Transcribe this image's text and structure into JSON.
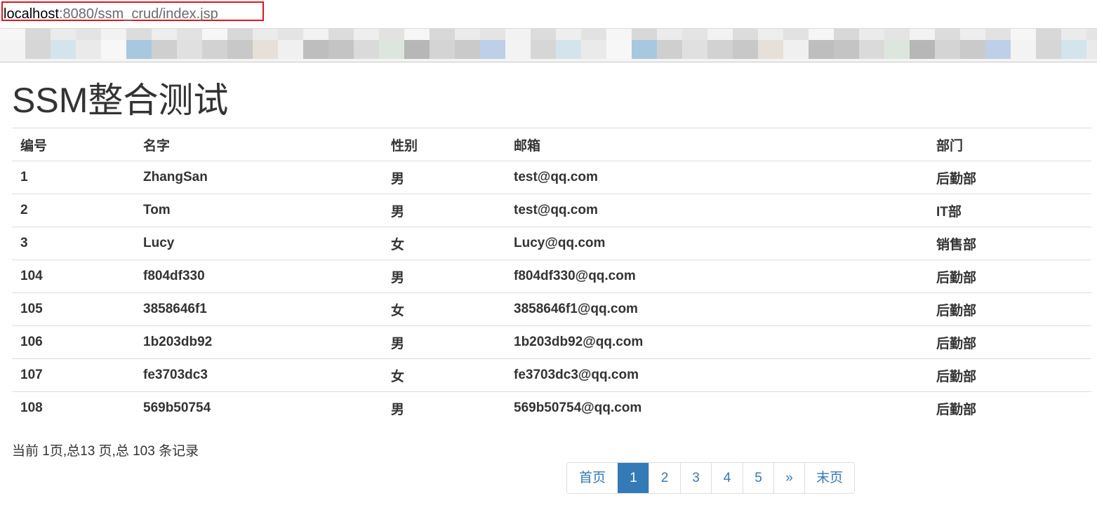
{
  "browser": {
    "url_host": "localhost",
    "url_path": ":8080/ssm_crud/index.jsp",
    "highlight_color": "#e0161b"
  },
  "page": {
    "title": "SSM整合测试"
  },
  "table": {
    "headers": [
      "编号",
      "名字",
      "性别",
      "邮箱",
      "部门"
    ],
    "rows": [
      [
        "1",
        "ZhangSan",
        "男",
        "test@qq.com",
        "后勤部"
      ],
      [
        "2",
        "Tom",
        "男",
        "test@qq.com",
        "IT部"
      ],
      [
        "3",
        "Lucy",
        "女",
        "Lucy@qq.com",
        "销售部"
      ],
      [
        "104",
        "f804df330",
        "男",
        "f804df330@qq.com",
        "后勤部"
      ],
      [
        "105",
        "3858646f1",
        "女",
        "3858646f1@qq.com",
        "后勤部"
      ],
      [
        "106",
        "1b203db92",
        "男",
        "1b203db92@qq.com",
        "后勤部"
      ],
      [
        "107",
        "fe3703dc3",
        "女",
        "fe3703dc3@qq.com",
        "后勤部"
      ],
      [
        "108",
        "569b50754",
        "男",
        "569b50754@qq.com",
        "后勤部"
      ]
    ]
  },
  "page_info": "当前 1页,总13 页,总 103 条记录",
  "pagination": {
    "first_label": "首页",
    "pages": [
      "1",
      "2",
      "3",
      "4",
      "5"
    ],
    "active_page": "1",
    "next_label": "»",
    "last_label": "末页",
    "accent_color": "#337ab7"
  }
}
